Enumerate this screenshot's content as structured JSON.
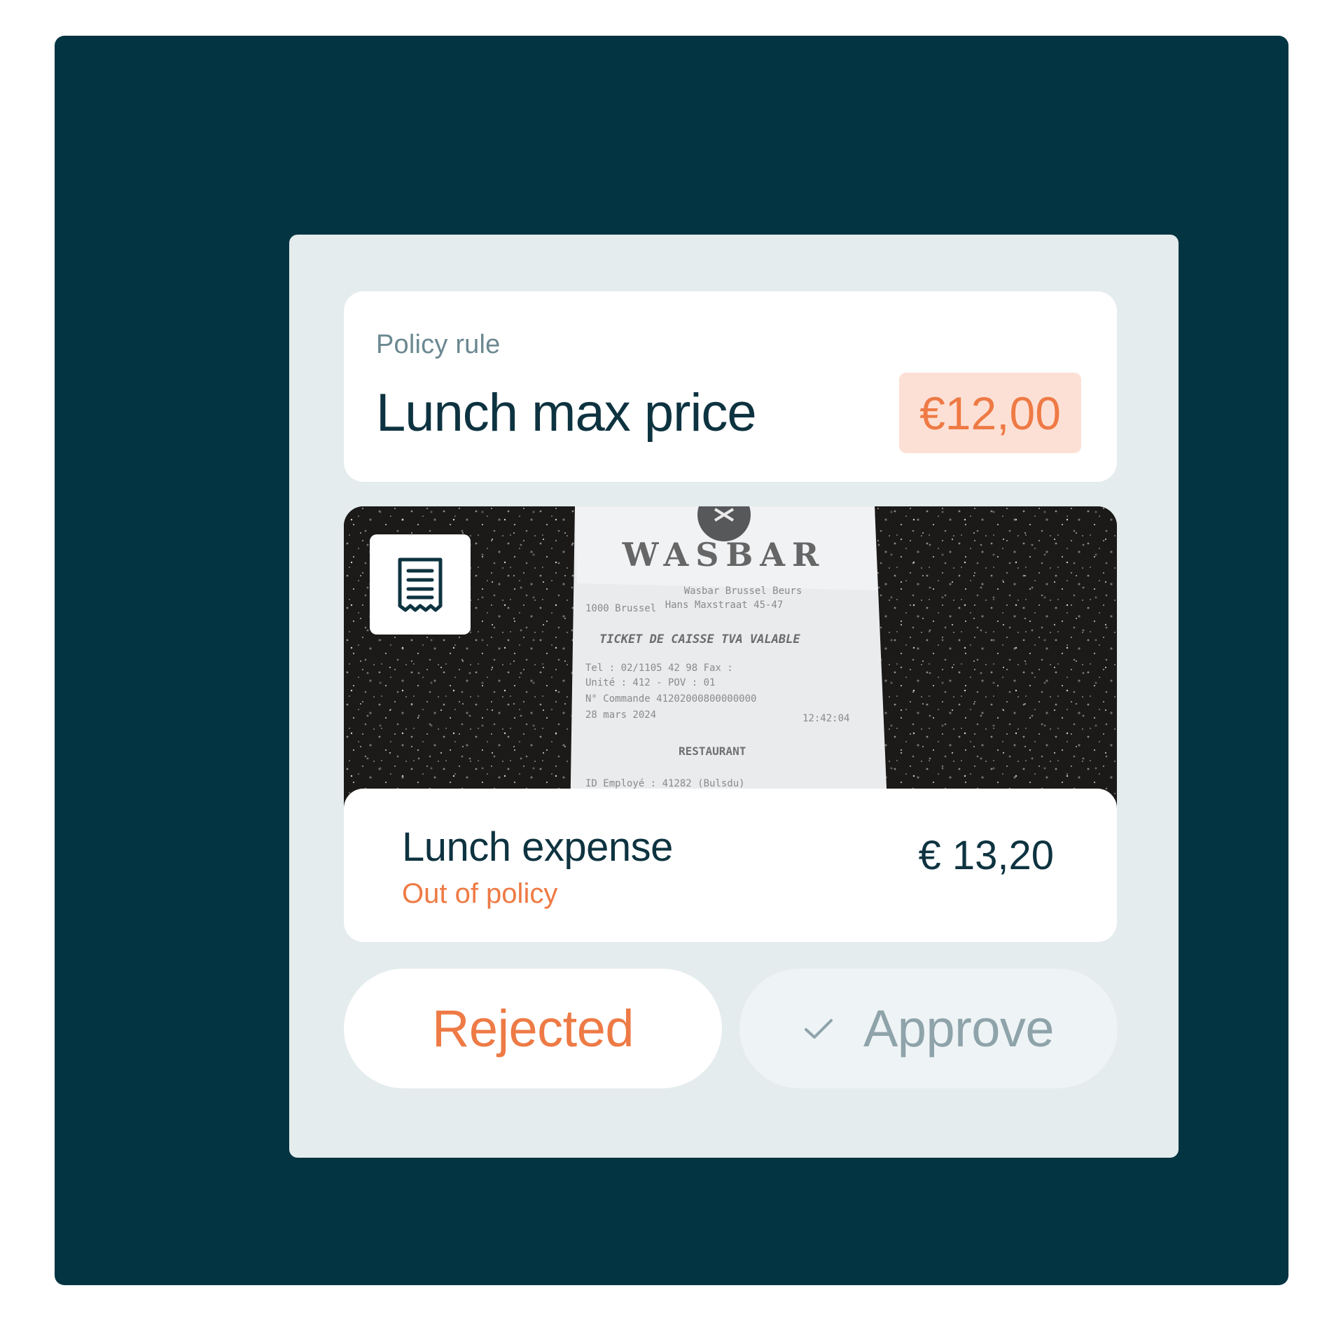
{
  "policy_rule": {
    "kicker": "Policy rule",
    "title": "Lunch max price",
    "limit": "€12,00"
  },
  "receipt": {
    "icon": "receipt-icon",
    "merchant": "WASBAR",
    "address_line1": "Wasbar Brussel Beurs",
    "address_line2": "Hans Maxstraat 45-47",
    "city": "1000 Brussel",
    "ticket_line": "TICKET DE CAISSE TVA VALABLE",
    "tel_line": "Tel : 02/1105 42 98     Fax :",
    "unit_line": "Unité : 412 - POV : 01",
    "order_line": "N° Commande       41202000800000000",
    "date": "28 mars 2024",
    "time": "12:42:04",
    "section": "RESTAURANT",
    "employee_line": "ID Employé    :  41282  (Bulsdu)"
  },
  "expense": {
    "title": "Lunch expense",
    "status": "Out of policy",
    "amount": "€ 13,20"
  },
  "actions": {
    "reject_label": "Rejected",
    "approve_label": "Approve",
    "approve_icon": "check-icon"
  },
  "colors": {
    "frame": "#023441",
    "panel": "#e4eced",
    "accent": "#ee7a45",
    "badge_bg": "#fde0d5",
    "text_dark": "#0e3340",
    "text_muted": "#6b8891"
  }
}
